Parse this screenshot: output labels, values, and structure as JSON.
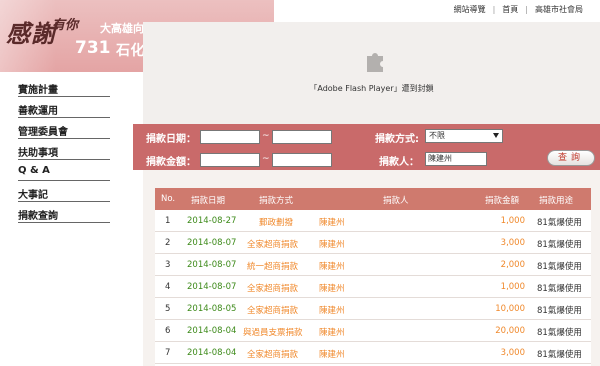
{
  "header": {
    "logo_big": "感謝",
    "logo_small": "有你",
    "logo_num": "731",
    "title_line1": "大高雄向前行",
    "title_line2": "石化氣爆善款資訊網",
    "top_links": [
      "網站導覽",
      "首頁",
      "高雄市社會局"
    ]
  },
  "sidebar": {
    "items": [
      "實施計畫",
      "善款運用",
      "管理委員會",
      "扶助事項",
      "Q & A",
      "大事記",
      "捐款查詢"
    ]
  },
  "flash": {
    "icon": "plugin-icon",
    "message": "「Adobe Flash Player」遭到封鎖"
  },
  "search": {
    "date_label": "捐款日期：",
    "date_from": "",
    "date_to": "",
    "tilde": "~",
    "method_label": "捐款方式:",
    "method_value": "不限",
    "amount_label": "捐款金額：",
    "amount_from": "",
    "amount_to": "",
    "donor_label": "捐款人：",
    "donor_value": "陳建州",
    "query_button": "查詢"
  },
  "table": {
    "headers": [
      "No.",
      "捐款日期",
      "捐款方式",
      "捐款人",
      "捐款金額",
      "捐款用途"
    ],
    "rows": [
      {
        "no": "1",
        "date": "2014-08-27",
        "method": "郵政劃撥",
        "donor": "陳建州",
        "amount": "1,000",
        "use": "81氣爆使用"
      },
      {
        "no": "2",
        "date": "2014-08-07",
        "method": "全家超商捐款",
        "donor": "陳建州",
        "amount": "3,000",
        "use": "81氣爆使用"
      },
      {
        "no": "3",
        "date": "2014-08-07",
        "method": "統一超商捐款",
        "donor": "陳建州",
        "amount": "2,000",
        "use": "81氣爆使用"
      },
      {
        "no": "4",
        "date": "2014-08-07",
        "method": "全家超商捐款",
        "donor": "陳建州",
        "amount": "1,000",
        "use": "81氣爆使用"
      },
      {
        "no": "5",
        "date": "2014-08-05",
        "method": "全家超商捐款",
        "donor": "陳建州",
        "amount": "10,000",
        "use": "81氣爆使用"
      },
      {
        "no": "6",
        "date": "2014-08-04",
        "method": "與過員支票捐款",
        "donor": "陳建州",
        "amount": "20,000",
        "use": "81氣爆使用"
      },
      {
        "no": "7",
        "date": "2014-08-04",
        "method": "全家超商捐款",
        "donor": "陳建州",
        "amount": "3,000",
        "use": "81氣爆使用"
      }
    ]
  }
}
